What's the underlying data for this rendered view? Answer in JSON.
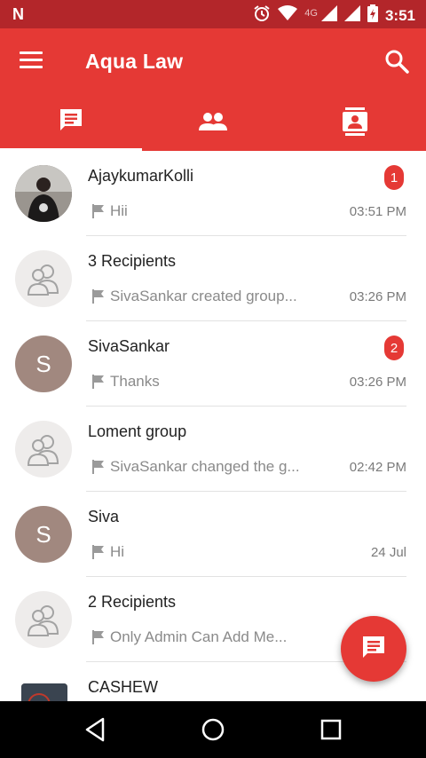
{
  "status_bar": {
    "app_icon": "N",
    "network_label": "4G",
    "time": "3:51"
  },
  "app_bar": {
    "title": "Aqua Law",
    "menu_icon": "hamburger-menu-icon",
    "search_icon": "search-icon"
  },
  "tabs": [
    {
      "icon": "chat-icon",
      "active": true
    },
    {
      "icon": "group-icon",
      "active": false
    },
    {
      "icon": "contact-card-icon",
      "active": false
    }
  ],
  "conversations": [
    {
      "name": "AjaykumarKolli",
      "preview": "Hii",
      "time": "03:51 PM",
      "badge": "1",
      "avatar": "photo"
    },
    {
      "name": "3 Recipients",
      "preview": "SivaSankar created group...",
      "time": "03:26 PM",
      "badge": "",
      "avatar": "group"
    },
    {
      "name": "SivaSankar",
      "preview": "Thanks",
      "time": "03:26 PM",
      "badge": "2",
      "avatar": "letter",
      "letter": "S"
    },
    {
      "name": "Loment group",
      "preview": "SivaSankar changed the g...",
      "time": "02:42 PM",
      "badge": "",
      "avatar": "group"
    },
    {
      "name": "Siva",
      "preview": "Hi",
      "time": "24 Jul",
      "badge": "",
      "avatar": "letter",
      "letter": "S"
    },
    {
      "name": "2 Recipients",
      "preview": "Only Admin Can Add Me...",
      "time": "",
      "badge": "",
      "avatar": "group"
    },
    {
      "name": "CASHEW",
      "preview": "",
      "time": "",
      "badge": "",
      "avatar": "photo"
    }
  ],
  "fab": {
    "icon": "new-message-icon"
  },
  "colors": {
    "primary": "#e53935",
    "status_bar": "#b3262a",
    "letter_avatar": "#a1887f"
  }
}
